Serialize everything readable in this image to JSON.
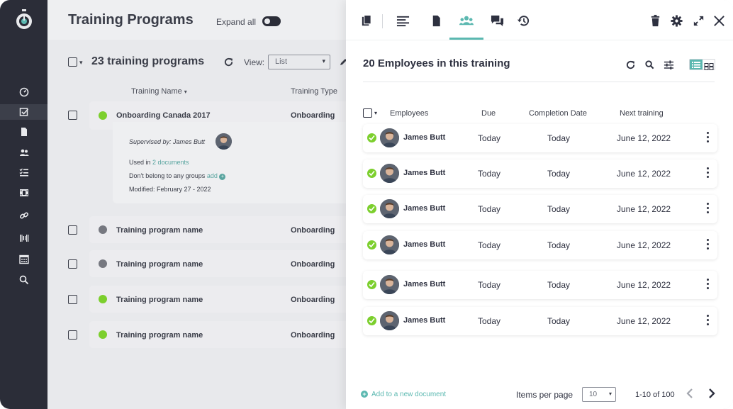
{
  "main": {
    "title": "Training Programs",
    "expand_label": "Expand all",
    "list_count": "23 training programs",
    "view_label": "View:",
    "view_select": "List",
    "col_training_name": "Training Name",
    "col_training_type": "Training Type",
    "expanded_row": {
      "name": "Onboarding Canada 2017",
      "type": "Onboarding",
      "status_color": "#7ccf2d",
      "supervised_by": "Supervised by: James Butt",
      "used_in_prefix": "Used in",
      "used_in_link": "2 documents",
      "groups_text": "Don't belong to any groups",
      "groups_link": "add",
      "modified": "Modified: February 27 - 2022"
    },
    "rows": [
      {
        "name": "Training program name",
        "type": "Onboarding",
        "status_color": "#767880"
      },
      {
        "name": "Training program name",
        "type": "Onboarding",
        "status_color": "#767880"
      },
      {
        "name": "Training program name",
        "type": "Onboarding",
        "status_color": "#7ccf2d"
      },
      {
        "name": "Training program name",
        "type": "Onboarding",
        "status_color": "#7ccf2d"
      }
    ]
  },
  "drawer": {
    "title": "20 Employees in this training",
    "columns": {
      "employees": "Employees",
      "due": "Due",
      "completion": "Completion Date",
      "next": "Next training"
    },
    "employees": [
      {
        "name": "James Butt",
        "due": "Today",
        "completion": "Today",
        "next": "June 12, 2022"
      },
      {
        "name": "James Butt",
        "due": "Today",
        "completion": "Today",
        "next": "June 12, 2022"
      },
      {
        "name": "James Butt",
        "due": "Today",
        "completion": "Today",
        "next": "June 12, 2022"
      },
      {
        "name": "James Butt",
        "due": "Today",
        "completion": "Today",
        "next": "June 12, 2022"
      },
      {
        "name": "James Butt",
        "due": "Today",
        "completion": "Today",
        "next": "June 12, 2022"
      },
      {
        "name": "James Butt",
        "due": "Today",
        "completion": "Today",
        "next": "June 12, 2022"
      }
    ],
    "footer": {
      "add_doc": "Add to a new document",
      "items_per_page_label": "Items per page",
      "items_per_page": "10",
      "range": "1-10 of 100"
    }
  },
  "colors": {
    "accent": "#5bb8b0",
    "success": "#7ccf2d",
    "nav_bg": "#2b2d38"
  }
}
